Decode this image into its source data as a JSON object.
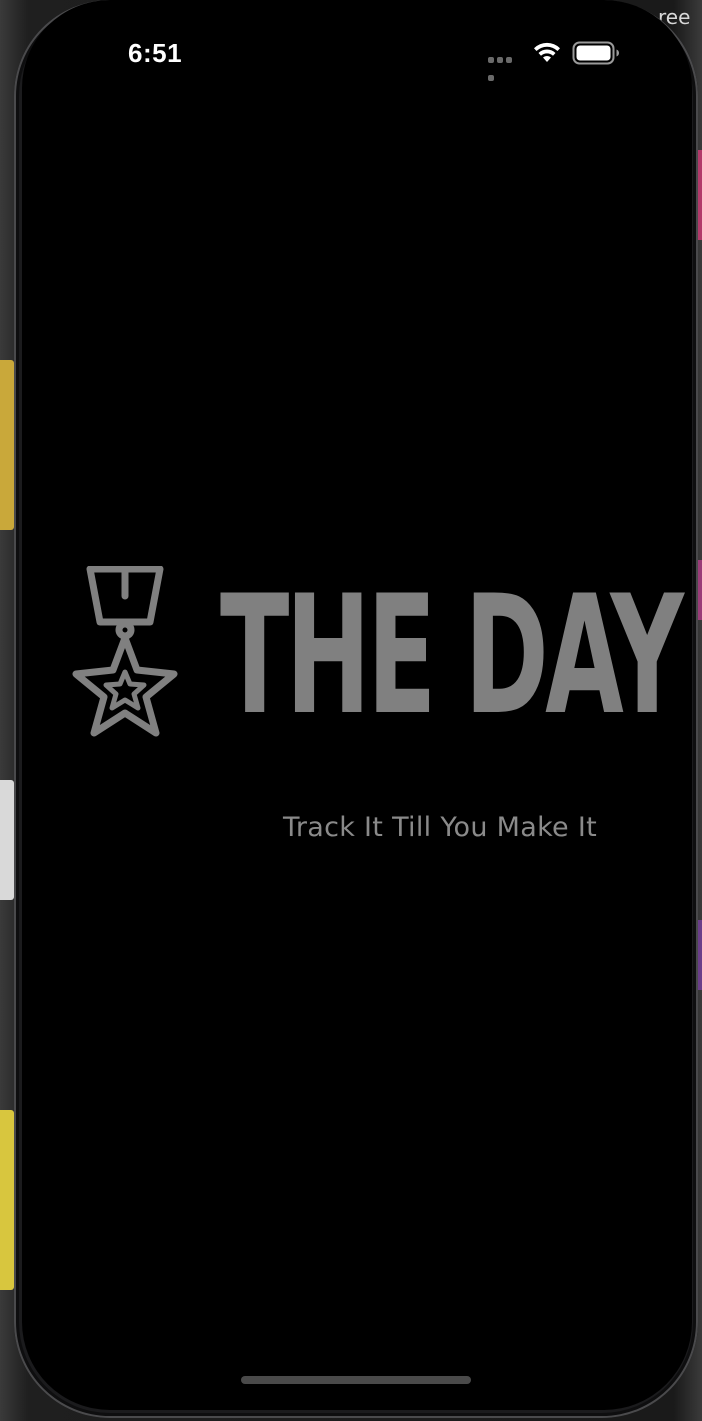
{
  "desktop": {
    "corner_text_line1": "ree",
    "corner_text_line2": "?."
  },
  "status_bar": {
    "time": "6:51",
    "signal_icon": "cellular-signal-icon",
    "wifi_icon": "wifi-icon",
    "battery_icon": "battery-icon"
  },
  "splash": {
    "logo_icon": "medal-star-icon",
    "title": "THE DAY",
    "tagline": "Track It Till You Make It"
  },
  "colors": {
    "screen_background": "#000000",
    "logo_gray": "#808080",
    "tagline_gray": "#8a8a8a",
    "status_text": "#ffffff"
  }
}
